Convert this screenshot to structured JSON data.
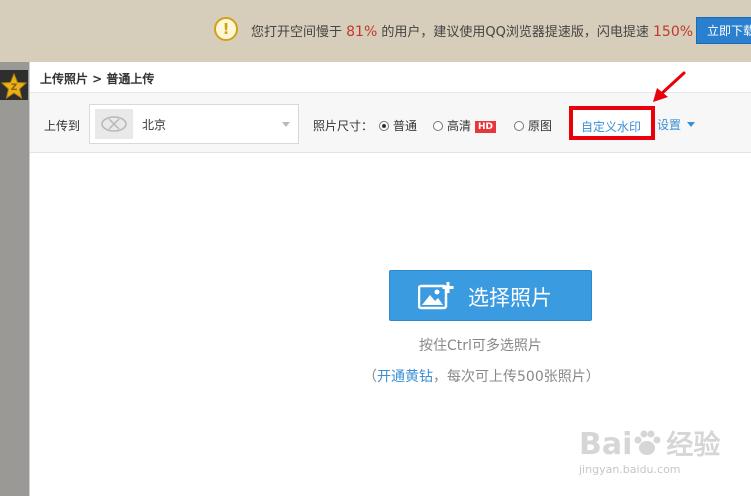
{
  "notice": {
    "icon": "exclamation-icon",
    "icon_glyph": "!",
    "text_before": "您打开空间慢于 ",
    "percent_slow": "81%",
    "text_middle": " 的用户，建议使用QQ浏览器提速版，闪电提速 ",
    "speed_up": "150%",
    "button_label": "立即下载"
  },
  "breadcrumb": "上传照片 > 普通上传",
  "toolbar": {
    "upload_to_label": "上传到",
    "album_name": "北京",
    "size_label": "照片尺寸：",
    "options": [
      {
        "label": "普通",
        "checked": true
      },
      {
        "label": "高清",
        "checked": false,
        "badge": "HD"
      },
      {
        "label": "原图",
        "checked": false
      }
    ],
    "watermark_label": "自定义水印",
    "settings_label": "设置"
  },
  "main": {
    "choose_button_label": "选择照片",
    "hint_ctrl": "按住Ctrl可多选照片",
    "hint2_open": "（",
    "hint2_link": "开通黄钻",
    "hint2_rest": "，每次可上传500张照片）"
  },
  "watermark": {
    "logo_latin": "Bai",
    "logo_cn": "经验",
    "url": "jingyan.baidu.com"
  },
  "colors": {
    "accent": "#3a9be0",
    "highlight_box": "#e8000b",
    "link": "#3a8fd6",
    "notice_bg": "#d7cdbb"
  }
}
